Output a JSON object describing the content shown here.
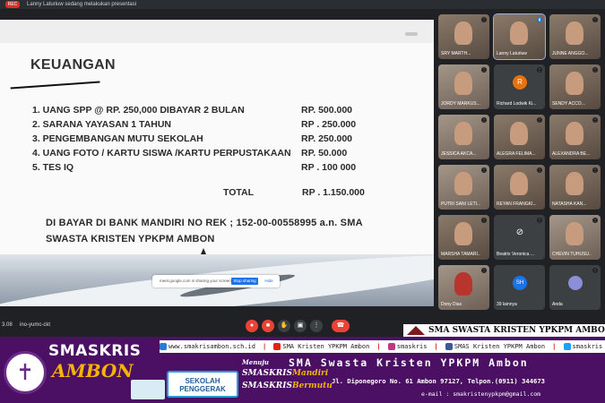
{
  "meeting": {
    "rec_label": "REC",
    "presenting_text": "Lanny Laturiuw sedang melakukan presentasi",
    "time": "3.08",
    "code": "ino-yumc-ckt"
  },
  "slide": {
    "title": "KEUANGAN",
    "fees": [
      {
        "label": "1.   UANG SPP  @ RP. 250,000    DIBAYAR 2  BULAN",
        "amount": "RP.  500.000"
      },
      {
        "label": "2.   SARANA YAYASAN  1 TAHUN",
        "amount": " RP . 250.000"
      },
      {
        "label": "3.   PENGEMBANGAN MUTU SEKOLAH",
        "amount": "  RP.   250.000"
      },
      {
        "label": "4.   UANG FOTO / KARTU SISWA /KARTU PERPUSTAKAAN",
        "amount": "  RP.    50.000"
      },
      {
        "label": "5.   TES IQ",
        "amount": "  RP . 100 000"
      }
    ],
    "total_label": "TOTAL",
    "total_amount": "RP . 1.150.000",
    "bank_line1": "DI BAYAR DI BANK MANDIRI NO REK ; 152-00-00558995 a.n.  SMA",
    "bank_line2": "SWASTA  KRISTEN  YPKPM  AMBON"
  },
  "share_bar": {
    "text": "meet.google.com is sharing your screen.",
    "stop_label": "Stop sharing",
    "hide_label": "Hide"
  },
  "participants": [
    {
      "name": "SRY MARTH...",
      "type": "cam"
    },
    {
      "name": "Lanny Laturiuw",
      "type": "cam",
      "active": true
    },
    {
      "name": "JUNNE ANGGO...",
      "type": "cam"
    },
    {
      "name": "JORDY MARKUS...",
      "type": "cam2"
    },
    {
      "name": "Richard Lodwik Ki...",
      "type": "avatar",
      "initial": "R",
      "color": "#e8710a"
    },
    {
      "name": "SENDY ACCO...",
      "type": "cam"
    },
    {
      "name": "JESSICA AKCA...",
      "type": "cam2"
    },
    {
      "name": "ALEGRA FELIMA...",
      "type": "cam"
    },
    {
      "name": "ALEXANDRA BE...",
      "type": "cam"
    },
    {
      "name": "PUTRI SANI LETI...",
      "type": "cam2"
    },
    {
      "name": "REYAN FRANGKI...",
      "type": "cam"
    },
    {
      "name": "NATASHA KAN...",
      "type": "cam"
    },
    {
      "name": "MARSHA TAMARI...",
      "type": "cam"
    },
    {
      "name": "Beatrix Veronica ...",
      "type": "avatar",
      "initial": "",
      "color": "#3c4043"
    },
    {
      "name": "CHEVIN TUHUSU...",
      "type": "cam2"
    },
    {
      "name": "Dony Dias",
      "type": "cam2"
    },
    {
      "name": "39 lainnya",
      "type": "avatar",
      "initial": "SH",
      "color": "#1a73e8"
    },
    {
      "name": "Anda",
      "type": "avatar",
      "initial": "",
      "color": "#8a8fd6"
    }
  ],
  "school_band": {
    "title": "SMA SWASTA KRISTEN YPKPM AMBON",
    "brand_line1": "SMASKRIS",
    "brand_line2": "AMBON",
    "website": "www.smakrisambon.sch.id",
    "youtube": "SMA Kristen YPKPM Ambon",
    "instagram": "smaskris",
    "facebook": "SMAS Kristen YPKPM Ambon",
    "twitter": "smaskris",
    "menuju": "Menuju",
    "school_name": "SMA Swasta Kristen YPKPM Ambon",
    "badge_line1": "SEKOLAH",
    "badge_line2": "PENGGERAK",
    "mandiri_prefix": "SMASKRIS",
    "mandiri_word": "Mandiri",
    "bermutu_prefix": "SMASKRIS",
    "bermutu_word": "Bermutu",
    "address": "Jl. Diponegoro  No. 61 Ambon 97127, Telpon.(0911) 344673",
    "email": "e-mail : smakristenypkpm@gmail.com"
  },
  "colors": {
    "banner_bg": "#4b0f63",
    "accent_gold": "#f4b400",
    "end_call_red": "#ea4335"
  }
}
